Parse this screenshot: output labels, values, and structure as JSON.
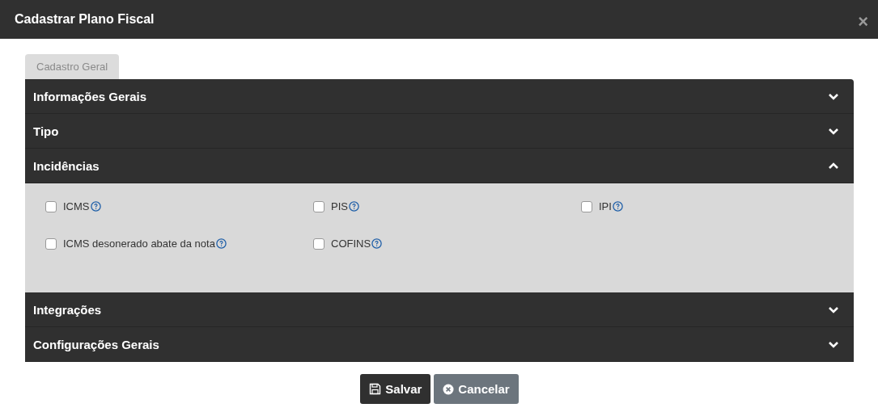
{
  "window": {
    "title": "Cadastrar Plano Fiscal",
    "close": "×"
  },
  "tabs": [
    {
      "label": "Cadastro Geral",
      "selected": true
    }
  ],
  "sections": [
    {
      "title": "Informações Gerais",
      "expanded": false
    },
    {
      "title": "Tipo",
      "expanded": false
    },
    {
      "title": "Incidências",
      "expanded": true,
      "options": [
        {
          "label": "ICMS",
          "checked": false
        },
        {
          "label": "PIS",
          "checked": false
        },
        {
          "label": "IPI",
          "checked": false
        },
        {
          "label": "ICMS desonerado abate da nota",
          "checked": false
        },
        {
          "label": "COFINS",
          "checked": false
        }
      ]
    },
    {
      "title": "Integrações",
      "expanded": false
    },
    {
      "title": "Configurações Gerais",
      "expanded": false
    }
  ],
  "buttons": [
    {
      "label": "Salvar",
      "kind": "primary"
    },
    {
      "label": "Cancelar",
      "kind": "secondary"
    }
  ]
}
